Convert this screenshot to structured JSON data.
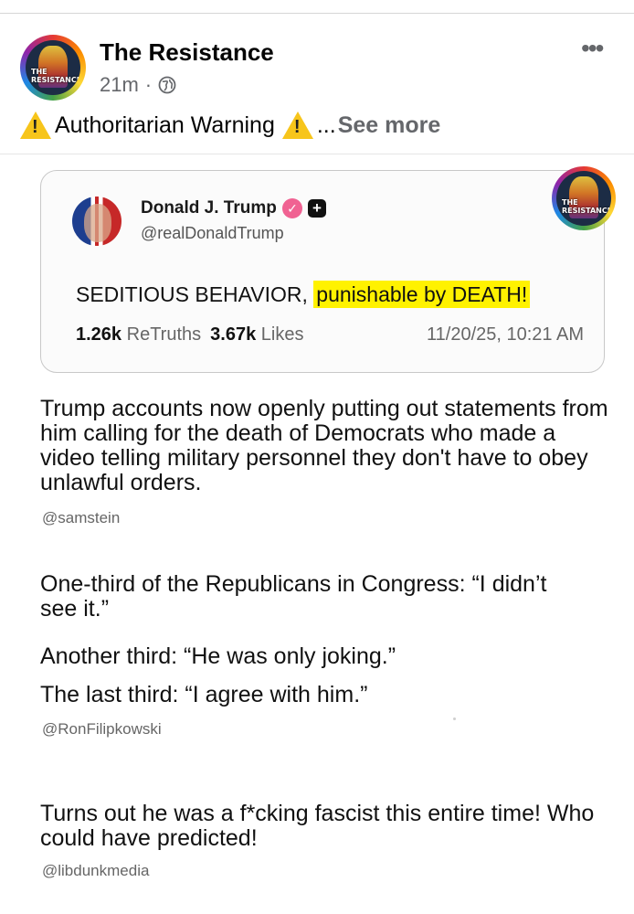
{
  "post": {
    "page_name": "The Resistance",
    "time": "21m",
    "separator": "·",
    "caption_text": "Authoritarian Warning",
    "caption_ellipsis": "...",
    "see_more": "See more",
    "more_icon": "•••",
    "avatar_text": "THE RESISTANCE",
    "avatar_text_line1": "THE",
    "avatar_text_line2": "RESISTANCE"
  },
  "truth": {
    "author_name": "Donald J. Trump",
    "handle": "@realDonaldTrump",
    "text_before": "SEDITIOUS BEHAVIOR, ",
    "text_highlight": "punishable by DEATH!",
    "retruths_count": "1.26k",
    "retruths_label": "ReTruths",
    "likes_count": "3.67k",
    "likes_label": "Likes",
    "datetime": "11/20/25, 10:21 AM",
    "verified_glyph": "✓",
    "plus_glyph": "+"
  },
  "blocks": [
    {
      "text": "Trump accounts now openly putting out statements from him calling for the death of Democrats who made a video telling military personnel they don't have to obey unlawful orders.",
      "handle": "@samstein"
    },
    {
      "line1": "One-third of the Republicans in Congress: “I didn’t see it.”",
      "line2": "Another third: “He was only joking.”",
      "line3": "The last third: “I agree with him.”",
      "handle": "@RonFilipkowski"
    },
    {
      "text": "Turns out he was a f*cking fascist this entire time! Who could have predicted!",
      "handle": "@libdunkmedia"
    }
  ],
  "colors": {
    "highlight": "#fff200",
    "warning": "#f7c51b",
    "secondary_text": "#65676b"
  }
}
